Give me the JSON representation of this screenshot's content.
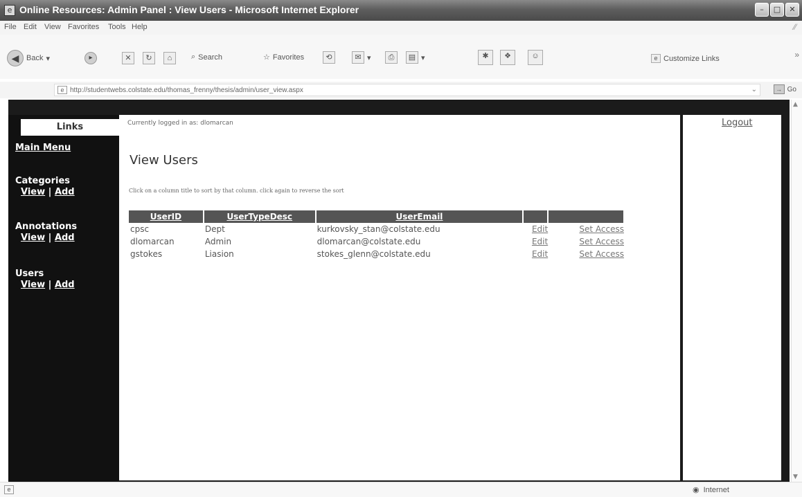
{
  "window": {
    "title": "Online Resources: Admin Panel : View Users - Microsoft Internet Explorer"
  },
  "menu": [
    "File",
    "Edit",
    "View",
    "Favorites",
    "Tools",
    "Help"
  ],
  "toolbar": {
    "back_label": "Back",
    "search_label": "Search",
    "favorites_label": "Favorites",
    "customize_label": "Customize Links"
  },
  "address": {
    "url": "http://studentwebs.colstate.edu/thomas_frenny/thesis/admin/user_view.aspx",
    "go_label": "Go"
  },
  "sidebar": {
    "heading": "Links",
    "main_menu": "Main Menu",
    "sections": [
      {
        "title": "Categories",
        "view": "View",
        "sep": " | ",
        "add": "Add"
      },
      {
        "title": "Annotations",
        "view": "View",
        "sep": " | ",
        "add": "Add"
      },
      {
        "title": "Users",
        "view": "View",
        "sep": " | ",
        "add": "Add"
      }
    ]
  },
  "main": {
    "logged_in": "Currently logged in as: dlomarcan",
    "title": "View Users",
    "instructions": "Click on a column title to sort by that column. click again to reverse the sort",
    "columns": [
      "UserID",
      "UserTypeDesc",
      "UserEmail",
      "",
      ""
    ],
    "rows": [
      {
        "id": "cpsc",
        "type": "Dept",
        "email": "kurkovsky_stan@colstate.edu",
        "edit": "Edit",
        "access": "Set Access"
      },
      {
        "id": "dlomarcan",
        "type": "Admin",
        "email": "dlomarcan@colstate.edu",
        "edit": "Edit",
        "access": "Set Access"
      },
      {
        "id": "gstokes",
        "type": "Liasion",
        "email": "stokes_glenn@colstate.edu",
        "edit": "Edit",
        "access": "Set Access"
      }
    ]
  },
  "right": {
    "logout": "Logout"
  },
  "status": {
    "zone": "Internet"
  }
}
